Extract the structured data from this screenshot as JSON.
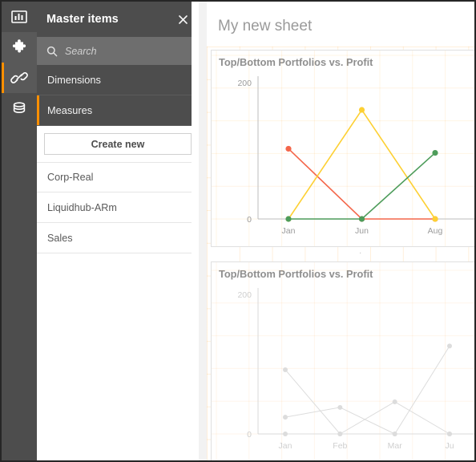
{
  "rail": {
    "items": [
      {
        "name": "chart-icon",
        "label": "Charts"
      },
      {
        "name": "puzzle-icon",
        "label": "Custom objects"
      },
      {
        "name": "link-icon",
        "label": "Master items"
      },
      {
        "name": "database-icon",
        "label": "Fields"
      }
    ]
  },
  "panel": {
    "title": "Master items",
    "close_label": "×",
    "search": {
      "placeholder": "Search",
      "value": ""
    },
    "tabs": [
      {
        "label": "Dimensions",
        "active": false
      },
      {
        "label": "Measures",
        "active": true
      }
    ],
    "create_label": "Create new",
    "items": [
      {
        "label": "Corp-Real"
      },
      {
        "label": "Liquidhub-ARm"
      },
      {
        "label": "Sales"
      }
    ]
  },
  "sheet": {
    "title": "My new sheet",
    "accent": "#ff8f00",
    "panel_bg": "#4d4d4d",
    "search_bg": "#6e6e6e"
  },
  "chart_data": [
    {
      "type": "line",
      "title": "Top/Bottom Portfolios vs. Profit",
      "categories": [
        "Jan",
        "Jun",
        "Aug"
      ],
      "xlabel": "",
      "ylabel": "",
      "ylim": [
        0,
        200
      ],
      "yticks": [
        0,
        200
      ],
      "ytick_labels": [
        "0",
        "200"
      ],
      "grid": true,
      "legend": "none",
      "state": "active",
      "series": [
        {
          "name": "red",
          "color": "#f4664a",
          "values": [
            103,
            0,
            0
          ]
        },
        {
          "name": "yellow",
          "color": "#fdd033",
          "values": [
            0,
            160,
            0
          ]
        },
        {
          "name": "green",
          "color": "#4d9c5a",
          "values": [
            0,
            0,
            97
          ]
        }
      ]
    },
    {
      "type": "line",
      "title": "Top/Bottom Portfolios vs. Profit",
      "categories": [
        "Jan",
        "Feb",
        "Mar",
        "Ju"
      ],
      "xlabel": "",
      "ylabel": "",
      "ylim": [
        0,
        200
      ],
      "yticks": [
        0,
        200
      ],
      "ytick_labels": [
        "0",
        "200"
      ],
      "grid": true,
      "legend": "none",
      "state": "loading",
      "series": [
        {
          "name": "series-1",
          "color": "#dcdcdc",
          "values": [
            92,
            0,
            0,
            126
          ]
        },
        {
          "name": "series-2",
          "color": "#dcdcdc",
          "values": [
            24,
            38,
            0,
            0
          ]
        },
        {
          "name": "series-3",
          "color": "#dcdcdc",
          "values": [
            0,
            0,
            46,
            0
          ]
        }
      ]
    }
  ]
}
